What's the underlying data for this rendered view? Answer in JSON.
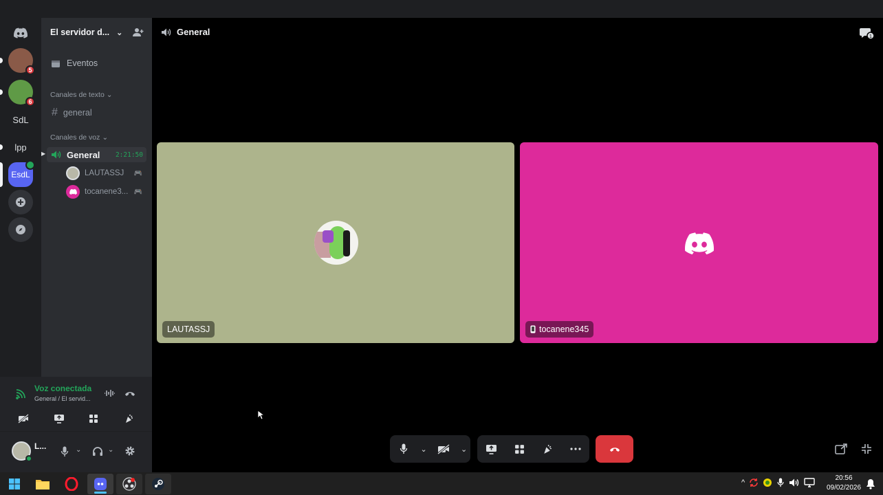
{
  "server_list": {
    "items": [
      {
        "kind": "avatar",
        "badge": "5"
      },
      {
        "kind": "avatar",
        "badge": "6"
      },
      {
        "kind": "text",
        "label": "SdL"
      },
      {
        "kind": "text",
        "label": "lpp"
      },
      {
        "kind": "text",
        "label": "EsdL"
      }
    ]
  },
  "guild": {
    "name": "El servidor d...",
    "events_label": "Eventos",
    "text_category": "Canales de texto",
    "text_channel": "general",
    "voice_category": "Canales de voz",
    "voice_channel": "General",
    "voice_timer": "2:21:50",
    "voice_users": [
      {
        "name": "LAUTASSJ"
      },
      {
        "name": "tocanene3..."
      }
    ]
  },
  "voice_status": {
    "title": "Voz conectada",
    "subtitle": "General / El servid..."
  },
  "user_panel": {
    "name": "L..."
  },
  "call": {
    "channel_title": "General",
    "participants": [
      {
        "name": "LAUTASSJ",
        "bg_color": "#adb48c"
      },
      {
        "name": "tocanene345",
        "bg_color": "#dd2a9b"
      }
    ]
  },
  "taskbar": {
    "time": "20:56",
    "date": "09/02/2026"
  },
  "colors": {
    "discord_blurple": "#5865f2",
    "connected_green": "#23a55a",
    "hangup_red": "#da373c"
  }
}
